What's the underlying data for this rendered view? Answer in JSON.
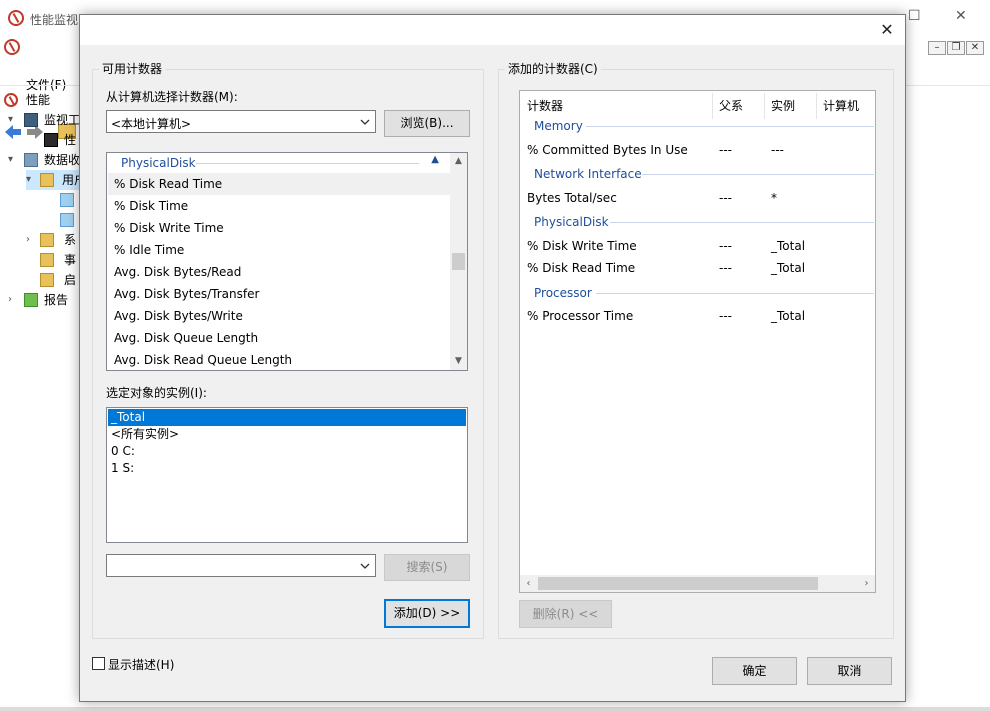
{
  "background_window": {
    "title": "性能监视",
    "menu_file": "文件(F)",
    "tree": [
      {
        "label": "性能"
      },
      {
        "label": "监视工"
      },
      {
        "label": "性"
      },
      {
        "label": "数据收"
      },
      {
        "label": "用户"
      },
      {
        "label": "系"
      },
      {
        "label": "事"
      },
      {
        "label": "启"
      },
      {
        "label": "报告"
      }
    ]
  },
  "dialog": {
    "close_glyph": "✕",
    "available": {
      "group_label": "可用计数器",
      "computer_label": "从计算机选择计数器(M):",
      "computer_value": "<本地计算机>",
      "browse_button": "浏览(B)...",
      "counter_header": "PhysicalDisk",
      "counters": [
        "% Disk Read Time",
        "% Disk Time",
        "% Disk Write Time",
        "% Idle Time",
        "Avg. Disk Bytes/Read",
        "Avg. Disk Bytes/Transfer",
        "Avg. Disk Bytes/Write",
        "Avg. Disk Queue Length",
        "Avg. Disk Read Queue Length"
      ],
      "instances_label": "选定对象的实例(I):",
      "instances": [
        "_Total",
        "<所有实例>",
        "0 C:",
        "1 S:"
      ],
      "search_value": "",
      "search_button": "搜索(S)",
      "add_button": "添加(D) >>"
    },
    "added": {
      "group_label": "添加的计数器(C)",
      "columns": [
        "计数器",
        "父系",
        "实例",
        "计算机"
      ],
      "groups": [
        {
          "name": "Memory",
          "rows": [
            {
              "counter": "% Committed Bytes In Use",
              "parent": "---",
              "instance": "---"
            }
          ]
        },
        {
          "name": "Network Interface",
          "rows": [
            {
              "counter": "Bytes Total/sec",
              "parent": "---",
              "instance": "*"
            }
          ]
        },
        {
          "name": "PhysicalDisk",
          "rows": [
            {
              "counter": "% Disk Write Time",
              "parent": "---",
              "instance": "_Total"
            },
            {
              "counter": "% Disk Read Time",
              "parent": "---",
              "instance": "_Total"
            }
          ]
        },
        {
          "name": "Processor",
          "rows": [
            {
              "counter": "% Processor Time",
              "parent": "---",
              "instance": "_Total"
            }
          ]
        }
      ],
      "remove_button": "删除(R) <<"
    },
    "show_description": "显示描述(H)",
    "ok_button": "确定",
    "cancel_button": "取消"
  }
}
